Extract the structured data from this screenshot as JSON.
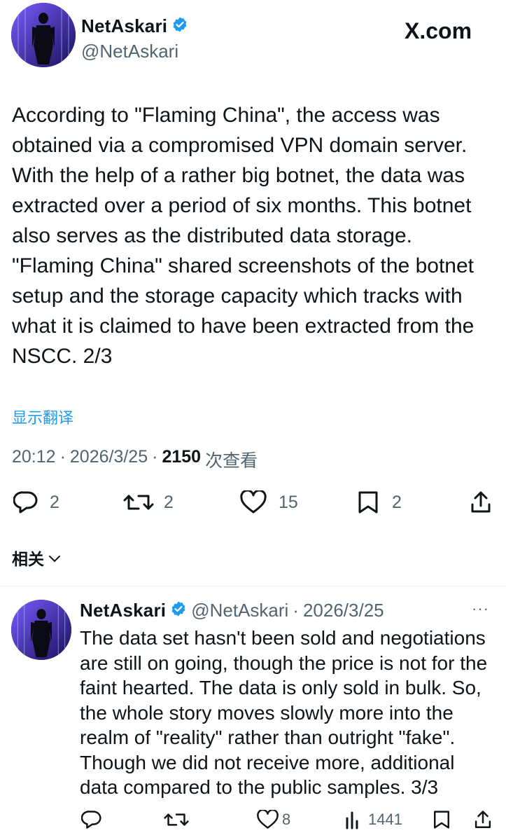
{
  "header": {
    "display_name": "NetAskari",
    "handle": "@NetAskari",
    "brand": "X.com"
  },
  "tweet": {
    "text": "According to \"Flaming China\", the access was obtained via a compromised VPN domain server. With the help of a rather big botnet, the data was extracted over a period of six months. This botnet also serves as the distributed data storage. \"Flaming China\" shared screenshots of the botnet setup and the storage capacity which tracks with what it is claimed to have been extracted from the NSCC.  2/3",
    "translate_label": "显示翻译",
    "time": "20:12",
    "date": "2026/3/25",
    "views_count": "2150",
    "views_label": "次查看",
    "separator": "·",
    "actions": {
      "replies": "2",
      "reposts": "2",
      "likes": "15",
      "bookmarks": "2"
    }
  },
  "related": {
    "label": "相关"
  },
  "reply": {
    "display_name": "NetAskari",
    "handle": "@NetAskari",
    "date": "2026/3/25",
    "separator": "·",
    "more_label": "···",
    "text": "The data set hasn't been sold and negotiations are still on going, though the price is not for the faint hearted. The data is only sold in bulk. So, the whole story moves slowly more into the realm of \"reality\" rather than outright \"fake\". Though we did not receive more, additional data compared to the public samples. 3/3",
    "actions": {
      "likes": "8",
      "views": "1441"
    }
  },
  "colors": {
    "accent": "#1d9bf0",
    "text": "#0f1419",
    "secondary": "#536471"
  }
}
